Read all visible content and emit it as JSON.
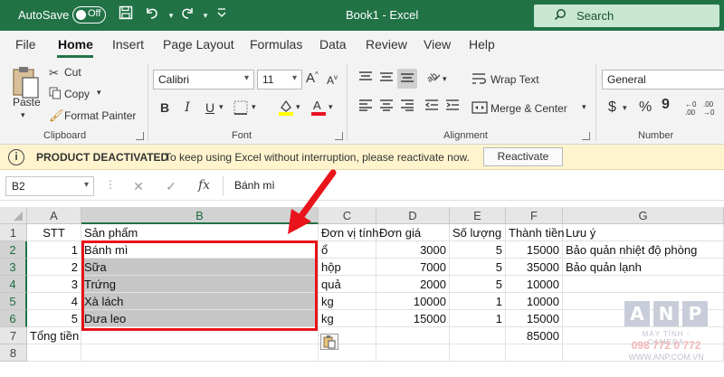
{
  "titlebar": {
    "autosave_label": "AutoSave",
    "autosave_state": "Off",
    "document_title": "Book1 - Excel",
    "search_placeholder": "Search",
    "accent_color": "#217346"
  },
  "menu": {
    "tabs": [
      "File",
      "Home",
      "Insert",
      "Page Layout",
      "Formulas",
      "Data",
      "Review",
      "View",
      "Help"
    ],
    "active": "Home"
  },
  "ribbon": {
    "clipboard": {
      "paste": "Paste",
      "cut": "Cut",
      "copy": "Copy",
      "format_painter": "Format Painter",
      "label": "Clipboard"
    },
    "font": {
      "family": "Calibri",
      "size": "11",
      "label": "Font",
      "bold": "B",
      "italic": "I",
      "underline": "U",
      "fill_color": "#ffff00",
      "font_color": "#e81123"
    },
    "alignment": {
      "wrap_text": "Wrap Text",
      "merge_center": "Merge & Center",
      "label": "Alignment"
    },
    "number": {
      "format": "General",
      "label": "Number",
      "currency": "$",
      "percent": "%"
    }
  },
  "notification": {
    "title": "PRODUCT DEACTIVATED",
    "message": "To keep using Excel without interruption, please reactivate now.",
    "button": "Reactivate"
  },
  "formula_bar": {
    "name_box": "B2",
    "fx": "fx",
    "content": "Bánh mì"
  },
  "sheet": {
    "columns": [
      "A",
      "B",
      "C",
      "D",
      "E",
      "F",
      "G"
    ],
    "selected_column": "B",
    "rows": [
      "1",
      "2",
      "3",
      "4",
      "5",
      "6",
      "7",
      "8"
    ],
    "selected_rows": [
      "2",
      "3",
      "4",
      "5",
      "6"
    ],
    "header_row": {
      "A": "STT",
      "B": "Sản phẩm",
      "C": "Đơn vị tính",
      "D": "Đơn giá",
      "E": "Số lượng",
      "F": "Thành tiền",
      "G": "Lưu ý"
    },
    "data_rows": [
      {
        "A": "1",
        "B": "Bánh mì",
        "C": "ổ",
        "D": "3000",
        "E": "5",
        "F": "15000",
        "G": "Bảo quản nhiệt độ phòng"
      },
      {
        "A": "2",
        "B": "Sữa",
        "C": "hộp",
        "D": "7000",
        "E": "5",
        "F": "35000",
        "G": "Bảo quản lạnh"
      },
      {
        "A": "3",
        "B": "Trứng",
        "C": "quả",
        "D": "2000",
        "E": "5",
        "F": "10000",
        "G": ""
      },
      {
        "A": "4",
        "B": "Xà lách",
        "C": "kg",
        "D": "10000",
        "E": "1",
        "F": "10000",
        "G": ""
      },
      {
        "A": "5",
        "B": "Dưa leo",
        "C": "kg",
        "D": "15000",
        "E": "1",
        "F": "15000",
        "G": ""
      }
    ],
    "total_row": {
      "A": "Tổng tiền",
      "F": "85000"
    }
  },
  "annotation": {
    "highlight_color": "#e8131b"
  },
  "watermark": {
    "letters": [
      "A",
      "N",
      "P"
    ],
    "line1": "MÁY TÍNH - CAMERA",
    "phone": "098 772 0 772",
    "website": "WWW.ANP.COM.VN"
  }
}
